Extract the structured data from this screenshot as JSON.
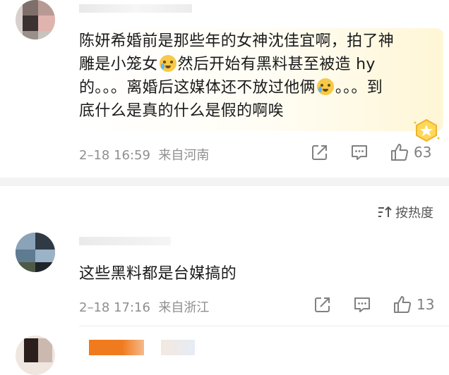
{
  "comments": [
    {
      "text_lines": [
        "陈妍希婚前是那些年的女神沈佳宜啊，拍了神",
        "雕是小笼女",
        "然后开始有黑料甚至被造 hy",
        "的。。。离婚后这媒体还不放过他俩",
        "。。。到",
        "底什么是真的什么是假的啊唉"
      ],
      "date": "2–18 16:59",
      "location": "来自河南",
      "likes": "63"
    },
    {
      "text": "这些黑料都是台媒搞的",
      "date": "2–18 17:16",
      "location": "来自浙江",
      "likes": "13"
    }
  ],
  "sort": {
    "label": "按热度",
    "icon": "sort-icon"
  },
  "icons": [
    "share-icon",
    "comment-icon",
    "like-icon",
    "crying-emoji-icon",
    "badge-icon"
  ]
}
